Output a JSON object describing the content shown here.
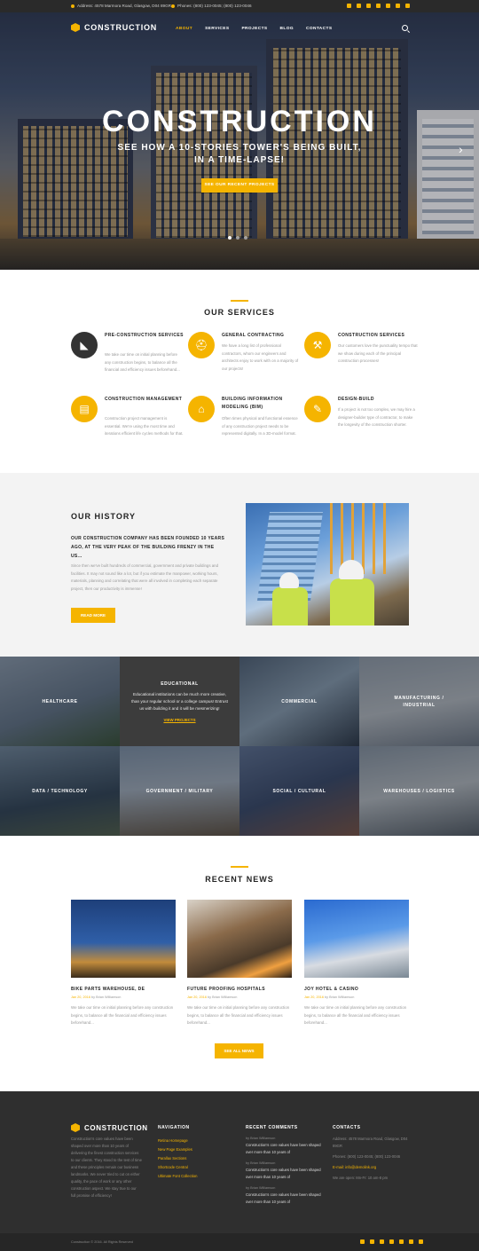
{
  "topbar": {
    "address": "Address: 4578 Marmora Road, Glasgow, D04 89GR",
    "phones": "Phones: (800) 123-0045; (800) 123-0046"
  },
  "header": {
    "logo": "CONSTRUCTION",
    "nav": [
      "ABOUT",
      "SERVICES",
      "PROJECTS",
      "BLOG",
      "CONTACTS"
    ]
  },
  "hero": {
    "title": "CONSTRUCTION",
    "subtitle_1": "SEE HOW A 10-STORIES TOWER'S BEING BUILT,",
    "subtitle_2": "IN A TIME-LAPSE!",
    "button": "SEE OUR RECENT PROJECTS"
  },
  "services": {
    "title": "OUR SERVICES",
    "items": [
      {
        "title": "PRE-CONSTRUCTION SERVICES",
        "desc": "We take our time on initial planning before any construction begins, to balance all the financial and efficiency issues beforehand..."
      },
      {
        "title": "GENERAL CONTRACTING",
        "desc": "We have a long list of professional contractors, whom our engineers and architects enjoy to work with on a majority of our projects!"
      },
      {
        "title": "CONSTRUCTION SERVICES",
        "desc": "Our customers love the punctuality tempo that we show during each of the principal construction processes!"
      },
      {
        "title": "CONSTRUCTION MANAGEMENT",
        "desc": "Construction project management is essential. We're using the most time and iterations efficient life cycles methods for that."
      },
      {
        "title": "BUILDING INFORMATION MODELING (BIM)",
        "desc": "Often times physical and functional essence of any construction project needs to be represented digitally. In a 3D-model format."
      },
      {
        "title": "DESIGN-BUILD",
        "desc": "If a project is not too complex, we may hire a designer-builder type of contractor, to make the longevity of the construction shorter."
      }
    ]
  },
  "history": {
    "title": "OUR HISTORY",
    "lead": "OUR CONSTRUCTION COMPANY HAS BEEN FOUNDED 10 YEARS AGO, AT THE VERY PEAK OF THE BUILDING FRENZY IN THE US...",
    "body": "Since then we've built hundreds of commercial, government and private buildings and facilities. It may not sound like a lot, but if you estimate the manpower, working hours, materials, planning and correlating that were all involved in completing each separate project, then our productivity is immense!",
    "button": "READ MORE"
  },
  "projects": {
    "tiles": [
      "HEALTHCARE",
      "EDUCATIONAL",
      "COMMERCIAL",
      "MANUFACTURING / INDUSTRIAL",
      "DATA / TECHNOLOGY",
      "GOVERNMENT / MILITARY",
      "SOCIAL / CULTURAL",
      "WAREHOUSES / LOGISTICS"
    ],
    "featured_desc": "Educational institutions can be much more creative, than your regular school or a college campus! Entrust us with building it and it will be mesmerizing!",
    "featured_link": "VIEW PROJECTS"
  },
  "news": {
    "title": "RECENT NEWS",
    "items": [
      {
        "title": "BIKE PARTS WAREHOUSE, DE",
        "date": "Jan 20, 2016",
        "author": "by Brian Williamson",
        "desc": "We take our time on initial planning before any construction begins, to balance all the financial and efficiency issues beforehand..."
      },
      {
        "title": "FUTURE PROOFING HOSPITALS",
        "date": "Jan 20, 2016",
        "author": "by Brian Williamson",
        "desc": "We take our time on initial planning before any construction begins, to balance all the financial and efficiency issues beforehand..."
      },
      {
        "title": "JOY HOTEL & CASINO",
        "date": "Jan 20, 2016",
        "author": "by Brian Williamson",
        "desc": "We take our time on initial planning before any construction begins, to balance all the financial and efficiency issues beforehand..."
      }
    ],
    "button": "SEE ALL NEWS"
  },
  "footer": {
    "logo": "CONSTRUCTION",
    "about": "Construction's core values have been shaped over more than 10 years of delivering the finest construction services to our clients. They stood to the test of time and these principles remain our business landmarks. We never tried to cut on either quality, the pace of work or any other construction aspect. We stay true to our full promise of efficiency!",
    "nav_title": "NAVIGATION",
    "nav": [
      "Retina Homepage",
      "New Page Examples",
      "Parallax Sections",
      "Shortcode Central",
      "Ultimate Font Collection"
    ],
    "comments_title": "RECENT COMMENTS",
    "comments": [
      {
        "author": "by Brian Williamson",
        "text": "Construction's core values have been shaped over more than 10 years of"
      },
      {
        "author": "by Brian Williamson",
        "text": "Construction's core values have been shaped over more than 10 years of"
      },
      {
        "author": "by Brian Williamson",
        "text": "Construction's core values have been shaped over more than 10 years of"
      }
    ],
    "contacts_title": "CONTACTS",
    "address": "Address: 4578 Marmora Road, Glasgow, D04 89GR",
    "phones": "Phones: (800) 123-0045; (800) 123-0046",
    "email": "E-mail: info@demolink.org",
    "hours": "We are open: Mn-Fr: 10 am-8 pm",
    "copyright": "Construction © 2016. All Rights Reserved"
  },
  "colors": {
    "accent": "#f5b400",
    "dark": "#2f2f2f"
  }
}
